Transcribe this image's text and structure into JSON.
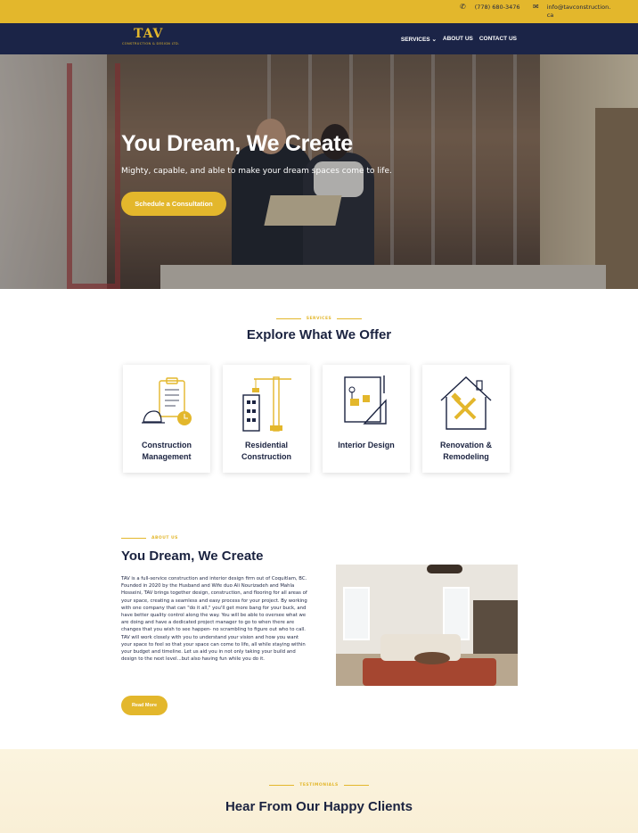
{
  "topbar": {
    "phone": "(778) 680-3476",
    "email": "info@tavconstruction.ca",
    "phone_icon": "phone-icon",
    "email_icon": "mail-icon"
  },
  "nav": {
    "logo_mark": "TAV",
    "logo_sub": "CONSTRUCTION & DESIGN LTD.",
    "items": [
      {
        "label": "SERVICES ⌄"
      },
      {
        "label": "ABOUT US"
      },
      {
        "label": "CONTACT US"
      }
    ]
  },
  "hero": {
    "title": "You Dream, We Create",
    "subtitle": "Mighty, capable, and able to make your dream spaces come to life.",
    "cta": "Schedule a Consultation"
  },
  "services": {
    "eyebrow": "SERVICES",
    "title": "Explore What We Offer",
    "cards": [
      {
        "label": "Construction Management",
        "icon": "clipboard-helmet-icon"
      },
      {
        "label": "Residential Construction",
        "icon": "crane-building-icon"
      },
      {
        "label": "Interior Design",
        "icon": "blueprint-ruler-icon"
      },
      {
        "label": "Renovation & Remodeling",
        "icon": "house-tools-icon"
      }
    ]
  },
  "about": {
    "eyebrow": "ABOUT US",
    "title": "You Dream, We Create",
    "text": "TAV is a full-service construction and interior design firm out of Coquitlam, BC. Founded in 2020 by the Husband and Wife duo Ali Nourizadeh and Mahla Hosseini, TAV brings together design, construction, and flooring for all areas of your space, creating a seamless and easy process for your project. By working with one company that can \"do it all,\" you'll get more bang for your buck, and have better quality control along the way. You will be able to oversee what we are doing and have a dedicated project manager to go to when there are changes that you wish to see happen- no scrambling to figure out who to call. TAV will work closely with you to understand your vision and how you want your space to feel so that your space can come to life, all while staying within your budget and timeline. Let us aid you in not only taking your build and design to the next level...but also having fun while you do it.",
    "cta": "Read More"
  },
  "testimonials": {
    "eyebrow": "TESTIMONIALS",
    "title": "Hear From Our Happy Clients"
  },
  "colors": {
    "accent": "#e3b72c",
    "navy": "#1b2447"
  }
}
